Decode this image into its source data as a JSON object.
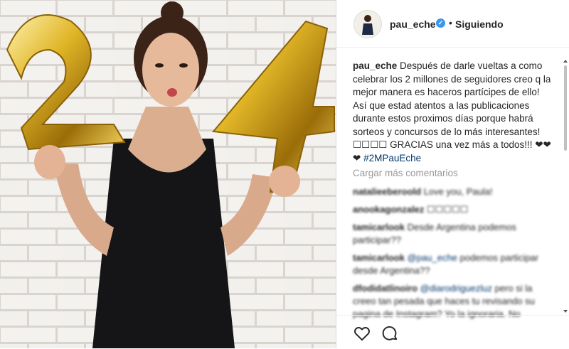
{
  "header": {
    "username": "pau_eche",
    "verified_icon": "verified-badge-icon",
    "separator": "•",
    "follow_status": "Siguiendo"
  },
  "caption": {
    "username": "pau_eche",
    "text": "Después de darle vueltas a como celebrar los 2 millones de seguidores creo q la mejor manera es haceros partícipes de ello! Así que estad atentos a las publicaciones durante estos proximos días porque habrá sorteos y concursos de lo más interesantes! ☐☐☐☐ GRACIAS una vez más a todos!!! ❤❤❤",
    "hashtag": "#2MPauEche"
  },
  "load_more_label": "Cargar más comentarios",
  "comments": [
    {
      "user": "natalieeberoold",
      "text": "Love you, Paula!",
      "mention": ""
    },
    {
      "user": "anookagonzalez",
      "text": "☐☐☐☐☐",
      "mention": ""
    },
    {
      "user": "tamicarlook",
      "text": "Desde Argentina podemos participar??",
      "mention": ""
    },
    {
      "user": "tamicarlook",
      "text": "podemos participar desde Argentina??",
      "mention": "@pau_eche"
    },
    {
      "user": "dfodidatlinoiro",
      "text": "pero si la creeo tan pesada que haces tu revisando su pagina de Instagram? Yo la ignoraria. No",
      "mention": "@diarodriguezluz"
    }
  ],
  "actions": {
    "like_icon": "heart-icon",
    "comment_icon": "comment-icon"
  },
  "colors": {
    "link_blue": "#003569",
    "verified_blue": "#3897f0",
    "muted_gray": "#999999",
    "gold": "#d4a017"
  }
}
